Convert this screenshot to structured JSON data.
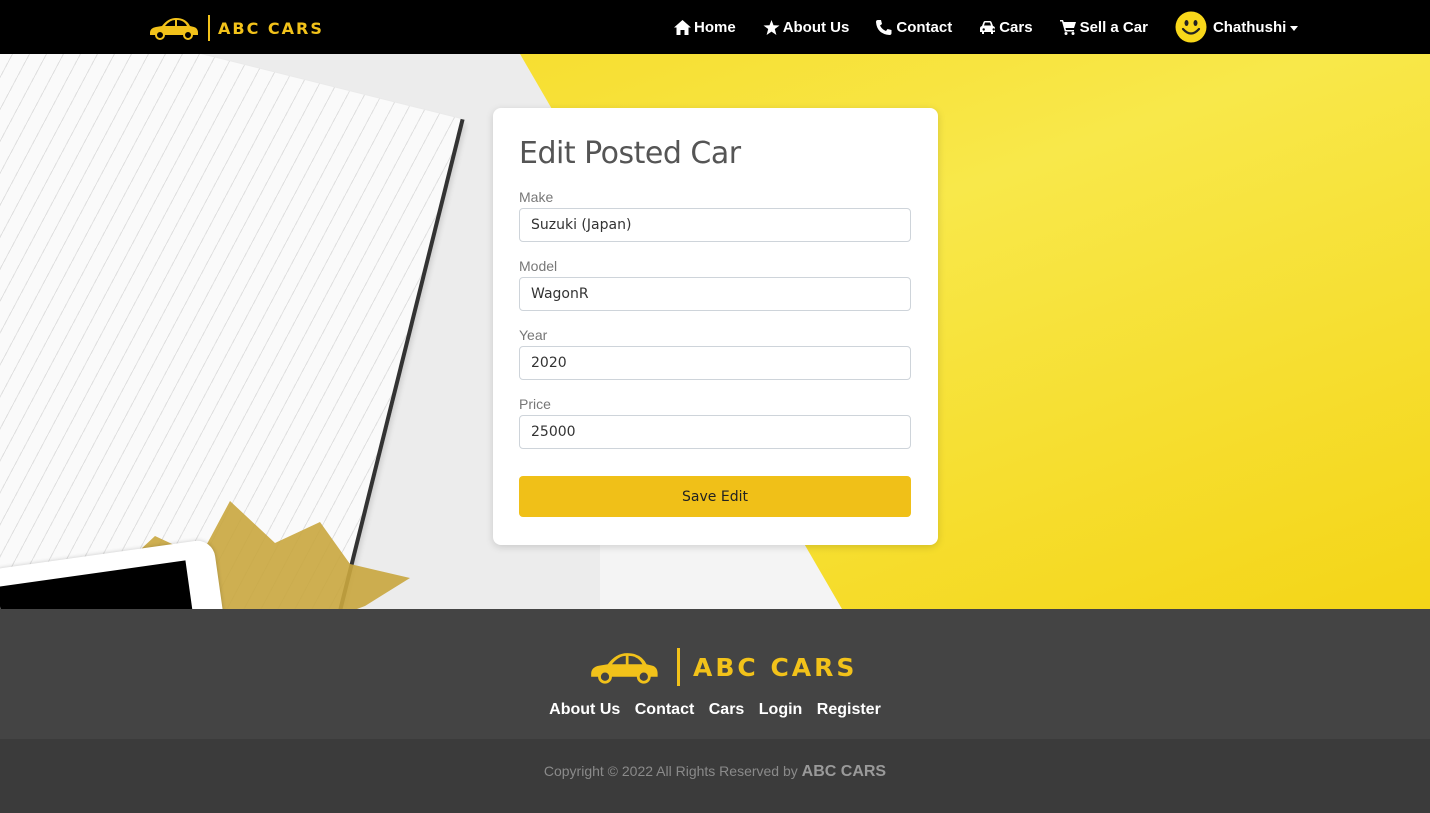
{
  "brand": {
    "name": "ABC CARS",
    "accent_color": "#f2c21a",
    "logo_icon": "car-icon"
  },
  "nav": {
    "links": [
      {
        "label": "Home",
        "icon": "home-icon"
      },
      {
        "label": "About Us",
        "icon": "star-icon"
      },
      {
        "label": "Contact",
        "icon": "phone-icon"
      },
      {
        "label": "Cars",
        "icon": "car-icon"
      },
      {
        "label": "Sell a Car",
        "icon": "cart-icon"
      }
    ],
    "user": {
      "name": "Chathushi",
      "avatar_icon": "smiley-icon"
    }
  },
  "form": {
    "title": "Edit Posted Car",
    "fields": [
      {
        "label": "Make",
        "value": "Suzuki (Japan)"
      },
      {
        "label": "Model",
        "value": "WagonR"
      },
      {
        "label": "Year",
        "value": "2020"
      },
      {
        "label": "Price",
        "value": "25000"
      }
    ],
    "submit_label": "Save Edit",
    "button_color": "#f0c018"
  },
  "footer": {
    "links": [
      "About Us",
      "Contact",
      "Cars",
      "Login",
      "Register"
    ],
    "copyright_text": "Copyright © 2022 All Rights Reserved by",
    "copyright_brand": "ABC CARS"
  }
}
